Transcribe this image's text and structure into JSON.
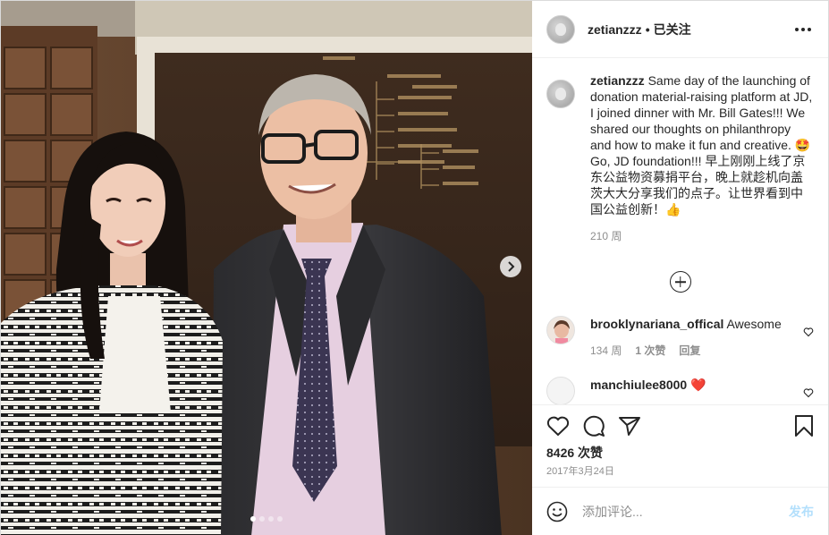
{
  "media": {
    "photo_icon": "photo-of-two-people",
    "next_icon": "chevron-right-icon",
    "carousel_count": 4,
    "carousel_active_index": 0
  },
  "header": {
    "username": "zetianzzz",
    "separator": "•",
    "follow_status": "已关注",
    "more_icon": "more-horizontal-icon"
  },
  "caption": {
    "username": "zetianzzz",
    "text": "Same day of the launching of donation material-raising platform at JD, I joined dinner with Mr. Bill Gates!!! We shared our thoughts on philanthropy and how to make it fun and creative. 🤩Go, JD foundation!!! 早上刚刚上线了京东公益物资募捐平台，晚上就趁机向盖茨大大分享我们的点子。让世界看到中国公益创新！👍",
    "time": "210 周"
  },
  "load_more_icon": "plus-circle-icon",
  "comments": [
    {
      "username": "brooklynariana_offical",
      "text": "Awesome",
      "time": "134 周",
      "likes": "1 次赞",
      "reply": "回复"
    },
    {
      "username": "manchiulee8000",
      "text": "❤️"
    }
  ],
  "actions": {
    "like_icon": "heart-icon",
    "comment_icon": "comment-bubble-icon",
    "share_icon": "paper-plane-icon",
    "save_icon": "bookmark-icon",
    "likes": "8426 次赞",
    "date": "2017年3月24日"
  },
  "add_comment": {
    "emoji_icon": "smiley-icon",
    "placeholder": "添加评论...",
    "post_label": "发布",
    "post_color": "#b2dffc"
  },
  "colors": {
    "text": "#262626",
    "secondary": "#8e8e8e",
    "border": "#dbdbdb",
    "heart_red": "#ed4956"
  }
}
